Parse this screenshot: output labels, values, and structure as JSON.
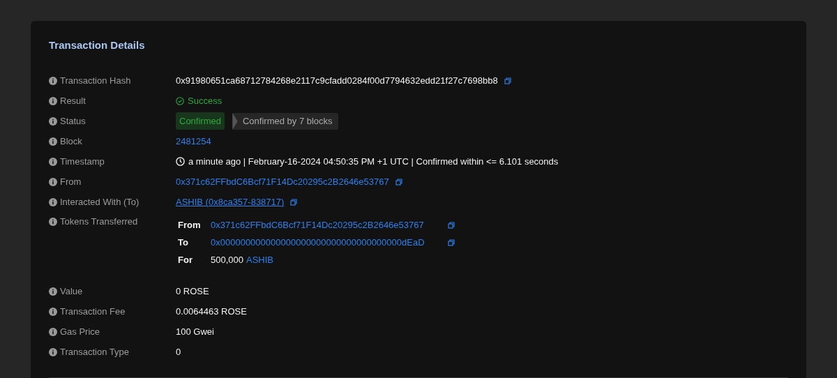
{
  "card": {
    "title": "Transaction Details"
  },
  "rows": [
    {
      "label": "Transaction Hash",
      "kind": "plain",
      "value": "0x91980651ca68712784268e2117c9cfadd0284f00d7794632edd21f27c7698bb8",
      "copyable": true
    },
    {
      "label": "Result",
      "kind": "success",
      "value": "Success"
    },
    {
      "label": "Status",
      "kind": "status",
      "badge": "Confirmed",
      "note": "Confirmed by 7 blocks"
    },
    {
      "label": "Block",
      "kind": "link",
      "value": "2481254"
    },
    {
      "label": "Timestamp",
      "kind": "timestamp",
      "value": "a minute ago | February-16-2024 04:50:35 PM +1 UTC | Confirmed within <= 6.101 seconds"
    },
    {
      "label": "From",
      "kind": "link",
      "value": "0x371c62FFbdC6Bcf71F14Dc20295c2B2646e53767",
      "copyable": true
    },
    {
      "label": "Interacted With (To)",
      "kind": "underlined_link",
      "value": "ASHIB (0x8ca357-838717)",
      "copyable": true
    },
    {
      "label": "Tokens Transferred",
      "kind": "tokens",
      "transfers": [
        {
          "label": "From",
          "value": "0x371c62FFbdC6Bcf71F14Dc20295c2B2646e53767",
          "copyable": true
        },
        {
          "label": "To",
          "value": "0x000000000000000000000000000000000000dEaD",
          "copyable": true
        },
        {
          "label": "For",
          "amount": "500,000",
          "token": "ASHIB"
        }
      ]
    },
    {
      "label": "Value",
      "kind": "plain",
      "value": "0 ROSE"
    },
    {
      "label": "Transaction Fee",
      "kind": "plain",
      "value": "0.0064463 ROSE"
    },
    {
      "label": "Gas Price",
      "kind": "plain",
      "value": "100 Gwei"
    },
    {
      "label": "Transaction Type",
      "kind": "plain",
      "value": "0"
    }
  ]
}
